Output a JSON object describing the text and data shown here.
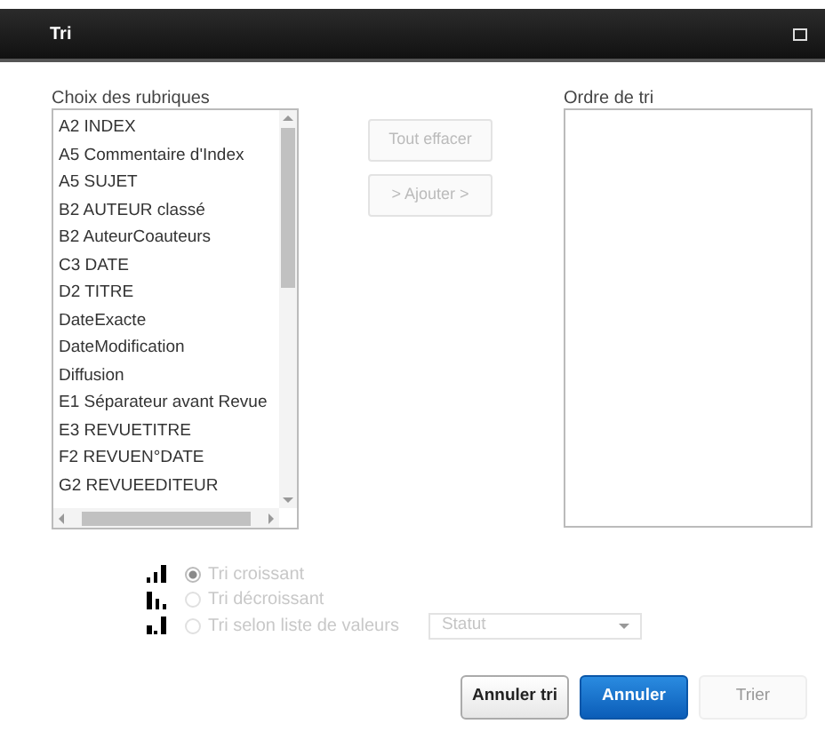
{
  "window": {
    "title": "Tri"
  },
  "fields": {
    "label": "Choix des rubriques",
    "items": [
      {
        "label": "A2 INDEX",
        "selected": false
      },
      {
        "label": "A5 Commentaire d'Index",
        "selected": false
      },
      {
        "label": "A5 SUJET",
        "selected": false
      },
      {
        "label": "B2 AUTEUR classé",
        "selected": false
      },
      {
        "label": "B2 AuteurCoauteurs",
        "selected": false
      },
      {
        "label": "C3 DATE",
        "selected": false
      },
      {
        "label": "D2 TITRE",
        "selected": false
      },
      {
        "label": "DateExacte",
        "selected": false
      },
      {
        "label": "DateModification",
        "selected": false
      },
      {
        "label": "Diffusion",
        "selected": false
      },
      {
        "label": "E1 Séparateur avant Revue",
        "selected": false
      },
      {
        "label": "E3 REVUETITRE",
        "selected": false
      },
      {
        "label": "F2 REVUEN°DATE",
        "selected": false
      },
      {
        "label": "G2 REVUEEDITEUR",
        "selected": false
      }
    ]
  },
  "middle_buttons": [
    {
      "label": "Tout effacer",
      "disabled": true
    },
    {
      "label": "> Ajouter >",
      "disabled": true
    }
  ],
  "sort_order": {
    "label": "Ordre de tri"
  },
  "sort_options": [
    {
      "label": "Tri croissant",
      "selected": true,
      "disabled": true
    },
    {
      "label": "Tri décroissant",
      "selected": false,
      "disabled": true
    },
    {
      "label": "Tri selon liste de valeurs",
      "selected": false,
      "disabled": true
    }
  ],
  "value_select": {
    "value": "Statut",
    "disabled": true
  },
  "buttons": [
    {
      "label": "Annuler tri",
      "kind": "default",
      "disabled": false
    },
    {
      "label": "Annuler",
      "kind": "primary",
      "disabled": false
    },
    {
      "label": "Trier",
      "kind": "default",
      "disabled": true
    }
  ]
}
